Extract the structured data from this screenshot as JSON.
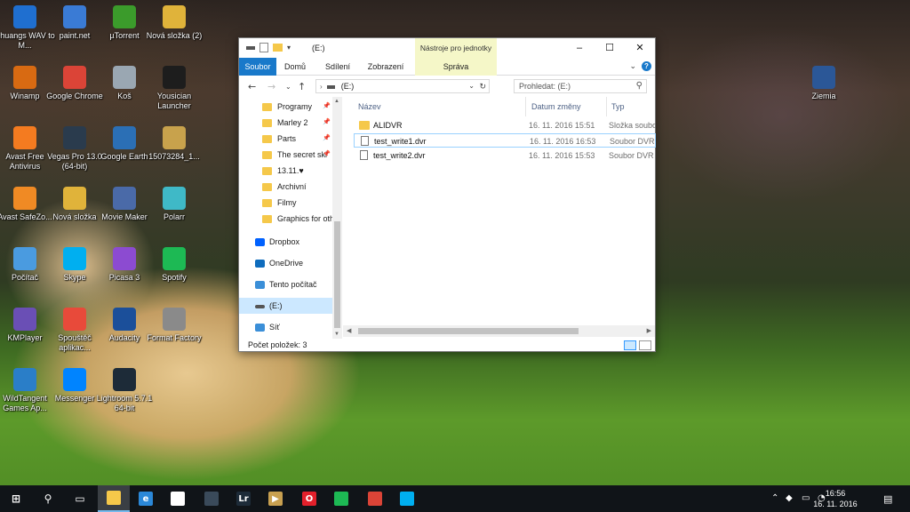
{
  "desktop": {
    "icons": [
      {
        "label": "Shuangs WAV to M...",
        "icon": "gear-icon",
        "color": "#1f6fd0"
      },
      {
        "label": "paint.net",
        "icon": "paintnet-icon",
        "color": "#3a7bd5"
      },
      {
        "label": "µTorrent",
        "icon": "utorrent-icon",
        "color": "#3b9b2b"
      },
      {
        "label": "Nová složka (2)",
        "icon": "folder-icon",
        "color": "#e0b33a"
      },
      {
        "label": "Winamp",
        "icon": "winamp-icon",
        "color": "#d86a12"
      },
      {
        "label": "Google Chrome",
        "icon": "chrome-icon",
        "color": "#db4437"
      },
      {
        "label": "Koš",
        "icon": "recycle-bin-icon",
        "color": "#9aa7b2"
      },
      {
        "label": "Yousician Launcher",
        "icon": "yousician-icon",
        "color": "#1d1d1d"
      },
      {
        "label": "Avast Free Antivirus",
        "icon": "avast-icon",
        "color": "#f47b20"
      },
      {
        "label": "Vegas Pro 13.0 (64-bit)",
        "icon": "vegas-icon",
        "color": "#2a3b4d"
      },
      {
        "label": "Google Earth",
        "icon": "google-earth-icon",
        "color": "#2b6fb5"
      },
      {
        "label": "15073284_1...",
        "icon": "image-file-icon",
        "color": "#c8a24c"
      },
      {
        "label": "Avast SafeZo...",
        "icon": "avast-safezone-icon",
        "color": "#f08a24"
      },
      {
        "label": "Nová složka",
        "icon": "folder-icon",
        "color": "#e0b33a"
      },
      {
        "label": "Movie Maker",
        "icon": "movie-maker-icon",
        "color": "#4a6aa8"
      },
      {
        "label": "Polarr",
        "icon": "polarr-icon",
        "color": "#3fb9c7"
      },
      {
        "label": "Počítač",
        "icon": "computer-icon",
        "color": "#4a9be0"
      },
      {
        "label": "Skype",
        "icon": "skype-icon",
        "color": "#00aff0"
      },
      {
        "label": "Picasa 3",
        "icon": "picasa-icon",
        "color": "#8c4bd1"
      },
      {
        "label": "Spotify",
        "icon": "spotify-icon",
        "color": "#1db954"
      },
      {
        "label": "KMPlayer",
        "icon": "kmplayer-icon",
        "color": "#6a4fb5"
      },
      {
        "label": "Spouštěč aplikac...",
        "icon": "app-launcher-icon",
        "color": "#e84a3a"
      },
      {
        "label": "Audacity",
        "icon": "audacity-icon",
        "color": "#1b4f9a"
      },
      {
        "label": "Format Factory",
        "icon": "format-factory-icon",
        "color": "#8a8a8a"
      },
      {
        "label": "WildTangent Games Ap...",
        "icon": "wildtangent-icon",
        "color": "#2a7ec8"
      },
      {
        "label": "Messenger",
        "icon": "messenger-icon",
        "color": "#0084ff"
      },
      {
        "label": "Lightroom 5.7.1 64-bit",
        "icon": "lightroom-icon",
        "color": "#1d2b38"
      },
      {
        "label": "Ziemia",
        "icon": "word-document-icon",
        "color": "#2b5797"
      }
    ]
  },
  "explorer": {
    "title": "(E:)",
    "context_tab": "Nástroje pro jednotky",
    "tabs": [
      "Soubor",
      "Domů",
      "Sdílení",
      "Zobrazení",
      "Správa"
    ],
    "address": "(E:)",
    "search_placeholder": "Prohledat: (E:)",
    "nav_items": [
      {
        "label": "Programy",
        "pinned": true
      },
      {
        "label": "Marley 2",
        "pinned": true
      },
      {
        "label": "Parts",
        "pinned": true
      },
      {
        "label": "The secret ski",
        "pinned": true
      },
      {
        "label": "13.11.♥",
        "pinned": false
      },
      {
        "label": "Archivní",
        "pinned": false
      },
      {
        "label": "Filmy",
        "pinned": false
      },
      {
        "label": "Graphics for oth",
        "pinned": false
      }
    ],
    "locations": [
      "Dropbox",
      "OneDrive",
      "Tento počítač",
      "(E:)",
      "Síť"
    ],
    "columns": [
      "Název",
      "Datum změny",
      "Typ"
    ],
    "files": [
      {
        "name": "ALIDVR",
        "date": "16. 11. 2016 15:51",
        "type": "Složka soubo",
        "kind": "folder"
      },
      {
        "name": "test_write1.dvr",
        "date": "16. 11. 2016 16:53",
        "type": "Soubor DVR",
        "kind": "file"
      },
      {
        "name": "test_write2.dvr",
        "date": "16. 11. 2016 15:53",
        "type": "Soubor DVR",
        "kind": "file"
      }
    ],
    "status": "Počet položek: 3"
  },
  "taskbar": {
    "apps": [
      "start-icon",
      "search-icon",
      "task-view-icon",
      "file-explorer-icon",
      "edge-icon",
      "store-icon",
      "vegas-icon",
      "lightroom-icon",
      "movie-player-icon",
      "opera-icon",
      "spotify-icon",
      "chrome-icon",
      "skype-icon"
    ],
    "time": "16:56",
    "date": "16. 11. 2016"
  }
}
